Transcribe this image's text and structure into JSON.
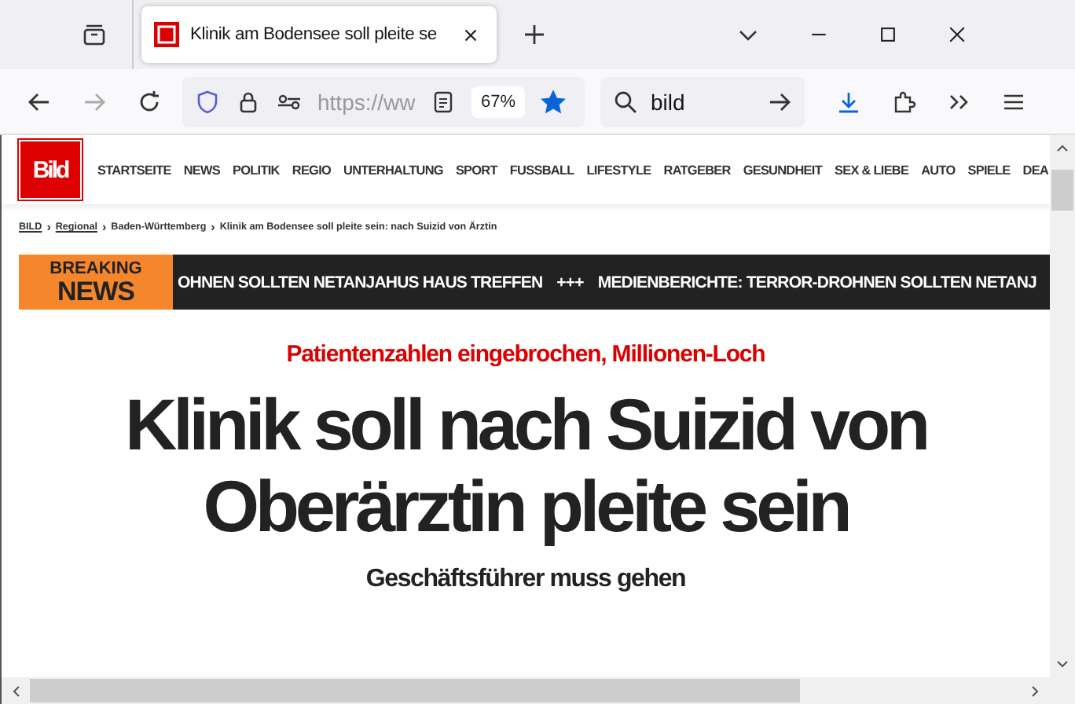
{
  "browser": {
    "tab": {
      "title": "Klinik am Bodensee soll pleite se",
      "selected": true
    },
    "url": "https://ww",
    "zoom": "67%",
    "bookmarked": true,
    "search": "bild"
  },
  "site": {
    "logo": "Bild",
    "nav": [
      "STARTSEITE",
      "NEWS",
      "POLITIK",
      "REGIO",
      "UNTERHALTUNG",
      "SPORT",
      "FUSSBALL",
      "LIFESTYLE",
      "RATGEBER",
      "GESUNDHEIT",
      "SEX & LIEBE",
      "AUTO",
      "SPIELE",
      "DEA"
    ],
    "breadcrumb_separator": "›",
    "breadcrumb": [
      {
        "label": "BILD",
        "link": true
      },
      {
        "label": "Regional",
        "link": true
      },
      {
        "label": "Baden-Württemberg",
        "link": false
      },
      {
        "label": "Klinik am Bodensee soll pleite sein: nach Suizid von Ärztin",
        "link": false
      }
    ],
    "breaking": {
      "label_top": "BREAKING",
      "label_bottom": "NEWS",
      "items": [
        "OHNEN SOLLTEN NETANJAHUS HAUS TREFFEN",
        "MEDIENBERICHTE: TERROR-DROHNEN SOLLTEN NETANJ"
      ],
      "separator": "+++"
    },
    "kicker": "Patientenzahlen eingebrochen, Millionen-Loch",
    "headline": "Klinik soll nach Suizid von Oberärztin pleite sein",
    "subheadline": "Geschäftsführer muss gehen"
  }
}
